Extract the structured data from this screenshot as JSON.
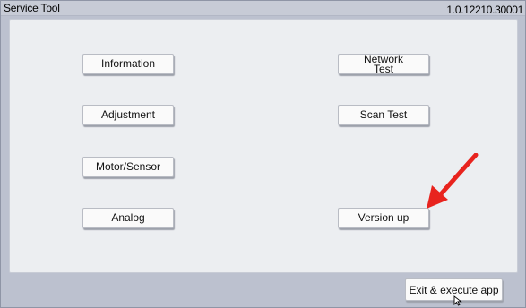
{
  "window": {
    "title": "Service Tool",
    "version": "1.0.12210.30001"
  },
  "buttons": {
    "information": "Information",
    "adjustment": "Adjustment",
    "motor_sensor": "Motor/Sensor",
    "analog": "Analog",
    "network_test": "Network\nTest",
    "scan_test": "Scan Test",
    "version_up": "Version up"
  },
  "footer": {
    "exit_execute": "Exit & execute app"
  },
  "annotation": {
    "arrow_color": "#e8231e",
    "arrow_icon": "red-arrow-icon"
  },
  "colors": {
    "window_bg": "#bcc1cf",
    "panel_bg": "#eceef1",
    "button_bg": "#fafafa"
  }
}
